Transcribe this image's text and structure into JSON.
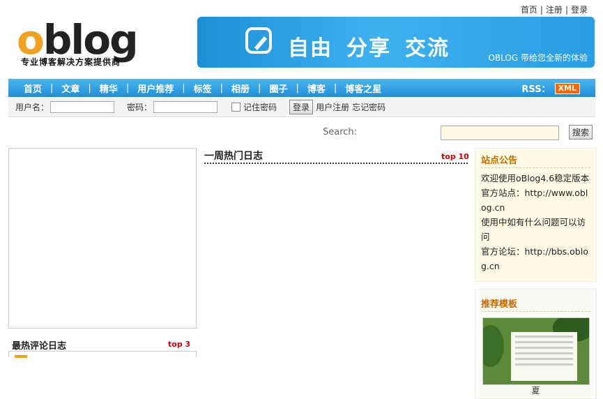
{
  "toplinks": {
    "home": "首页",
    "register": "注册",
    "login": "登录",
    "sep": "|"
  },
  "logo": {
    "o": "o",
    "rest": "blog",
    "tagline": "专业博客解决方案提供商"
  },
  "banner": {
    "slogan": [
      "自由",
      "分享",
      "交流"
    ],
    "sub": "OBLOG 带给您全新的体验"
  },
  "nav": {
    "items": [
      "首页",
      "文章",
      "精华",
      "用户推荐",
      "标签",
      "相册",
      "圈子",
      "博客",
      "博客之星"
    ],
    "rss": "RSS：",
    "xml": "XML"
  },
  "loginbar": {
    "user_label": "用户名：",
    "pass_label": "密码：",
    "remember": "记住密码",
    "login_btn": "登录",
    "register": "用户注册",
    "forgot": "忘记密码"
  },
  "search": {
    "label": "Search:",
    "button": "搜索"
  },
  "left": {
    "title": "最热评论日志",
    "top": "top 3"
  },
  "mid": {
    "title": "一周热门日志",
    "top": "top 10"
  },
  "notice": {
    "title": "站点公告",
    "lines": [
      "欢迎使用oBlog4.6稳定版本",
      "官方站点：http://www.oblog.cn",
      "使用中如有什么问题可以访问",
      "官方论坛：http://bbs.oblog.cn"
    ]
  },
  "template": {
    "title": "推荐模板",
    "caption": "夏"
  },
  "colors": {
    "nav": "#1e8fd8",
    "accent": "#c66a00",
    "badge": "#ff6600"
  }
}
